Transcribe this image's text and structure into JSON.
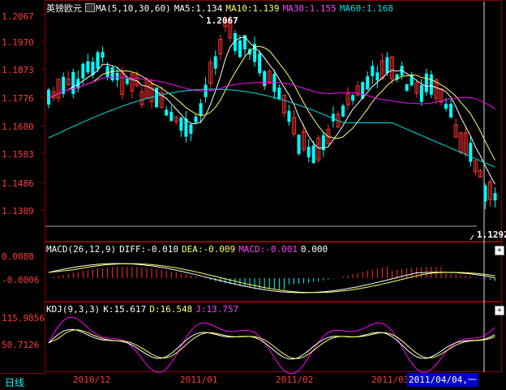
{
  "main_panel": {
    "instrument": "英镑欧元",
    "ma_legend": "MA(5,10,30,60)",
    "ma5": "MA5:1.134",
    "ma10": "MA10:1.139",
    "ma30": "MA30:1.155",
    "ma60": "MA60:1.168",
    "y_ticks": [
      "1.2067",
      "1.1970",
      "1.1873",
      "1.1776",
      "1.1680",
      "1.1583",
      "1.1486",
      "1.1389"
    ],
    "high_label": "1.2067",
    "low_label": "1.1292"
  },
  "macd_panel": {
    "legend": "MACD(26,12,9)",
    "diff": "DIFF:-0.010",
    "dea": "DEA:-0.009",
    "macd": "MACD:-0.001",
    "extra": "0.000",
    "y_ticks": [
      "0.0088",
      "-0.0006"
    ]
  },
  "kdj_panel": {
    "legend": "KDJ(9,3,3)",
    "k": "K:15.617",
    "d": "D:16.548",
    "j": "J:13.757",
    "y_ticks": [
      "115.9856",
      "50.7126"
    ]
  },
  "bottom_bar": {
    "period": "日线",
    "dates": [
      "2010/12",
      "2011/01",
      "2011/02",
      "2011/03"
    ],
    "cursor_date": "2011/04/04,一"
  },
  "colors": {
    "up": "#ff3030",
    "down": "#00ffff",
    "ma5": "#ffffff",
    "ma10": "#ffff66",
    "ma30": "#ff00ff",
    "ma60": "#00e0e0",
    "border": "#8b0000"
  }
}
